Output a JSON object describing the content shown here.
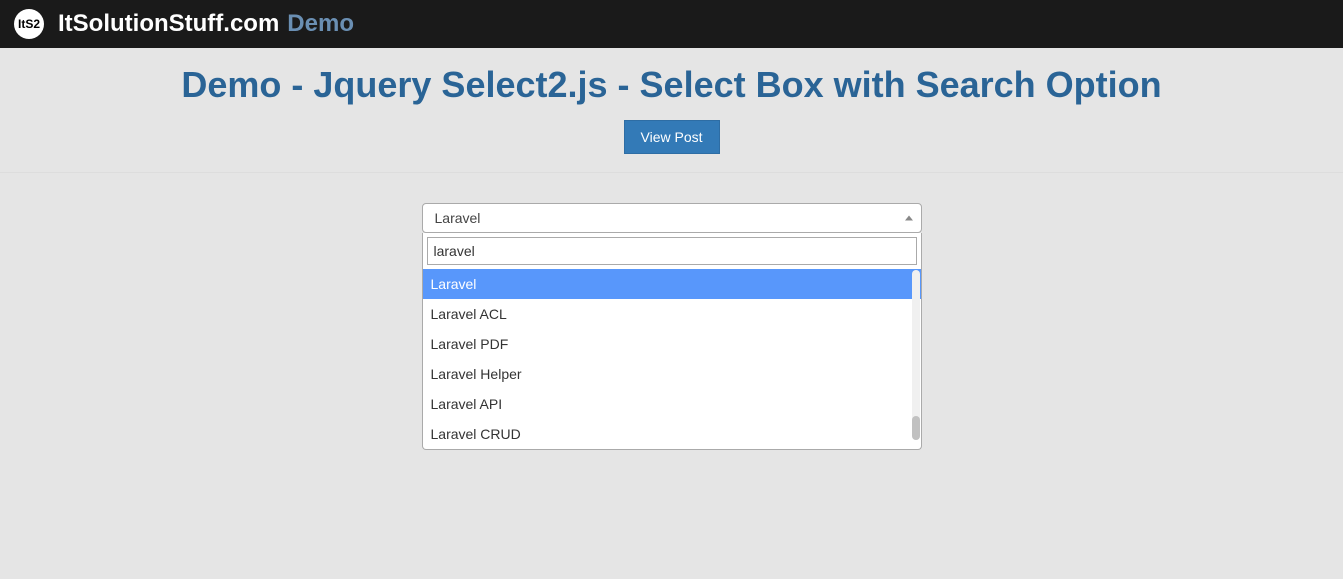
{
  "navbar": {
    "logo_text": "ItS2",
    "brand": "ItSolutionStuff.com",
    "demo_label": "Demo"
  },
  "page": {
    "title": "Demo - Jquery Select2.js - Select Box with Search Option",
    "view_post_label": "View Post"
  },
  "select2": {
    "selected": "Laravel",
    "search_value": "laravel",
    "options": [
      {
        "label": "Laravel",
        "highlighted": true
      },
      {
        "label": "Laravel ACL",
        "highlighted": false
      },
      {
        "label": "Laravel PDF",
        "highlighted": false
      },
      {
        "label": "Laravel Helper",
        "highlighted": false
      },
      {
        "label": "Laravel API",
        "highlighted": false
      },
      {
        "label": "Laravel CRUD",
        "highlighted": false
      }
    ]
  }
}
